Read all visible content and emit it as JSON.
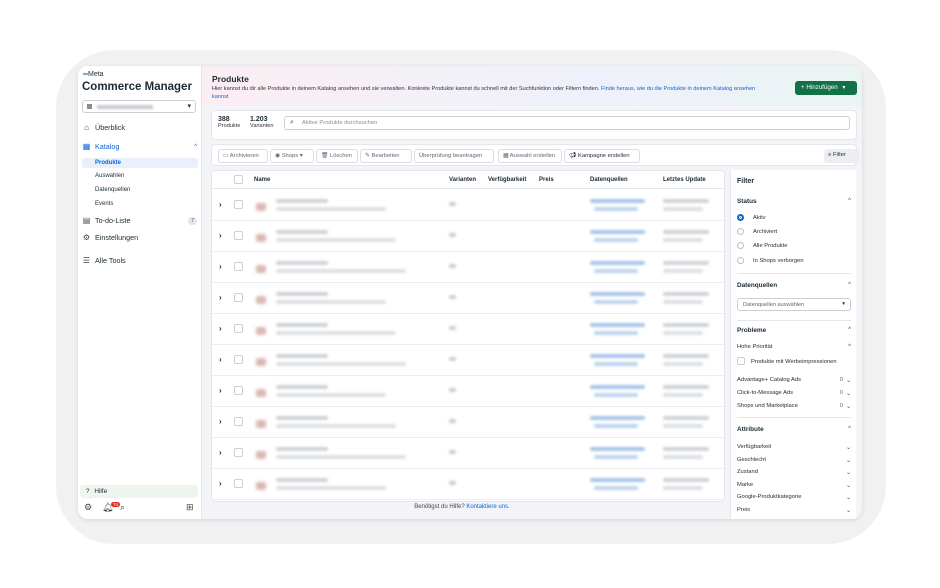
{
  "sidebar": {
    "brand": "Meta",
    "app_title": "Commerce Manager",
    "nav": {
      "overview": "Überblick",
      "catalog": "Katalog",
      "todo": "To-do-Liste",
      "todo_count": "7",
      "settings": "Einstellungen",
      "all_tools": "Alle Tools"
    },
    "catalog_sub": [
      "Produkte",
      "Auswahlen",
      "Datenquellen",
      "Events"
    ],
    "help": "Hilfe",
    "notification_count": "74"
  },
  "header": {
    "title": "Produkte",
    "description": "Hier kannst du dir alle Produkte in deinem Katalog ansehen und sie verwalten. Konkrete Produkte kannst du schnell mit der Suchfunktion oder Filtern finden.",
    "link": "Finde heraus, wie du die Produkte in deinem Katalog ansehen kannst",
    "add_button": "Hinzufügen"
  },
  "stats": {
    "products_count": "388",
    "products_label": "Produkte",
    "variants_count": "1.203",
    "variants_label": "Varianten"
  },
  "search": {
    "placeholder": "Aktive Produkte durchsuchen"
  },
  "toolbar": {
    "archive": "Archivieren",
    "shops": "Shops",
    "delete": "Löschen",
    "edit": "Bearbeiten",
    "review": "Überprüfung beantragen",
    "selection": "Auswahl erstellen",
    "campaign": "Kampagne erstellen",
    "filter": "Filter"
  },
  "table": {
    "columns": [
      "Name",
      "Varianten",
      "Verfügbarkeit",
      "Preis",
      "Datenquellen",
      "Letztes Update"
    ],
    "row_count": 10
  },
  "footer": {
    "text": "Benötigst du Hilfe?",
    "link": "Kontaktiere uns."
  },
  "filters": {
    "title": "Filter",
    "status": {
      "title": "Status",
      "options": [
        "Aktiv",
        "Archiviert",
        "Alle Produkte",
        "In Shops verborgen"
      ],
      "selected": "Aktiv"
    },
    "datasources": {
      "title": "Datenquellen",
      "select_placeholder": "Datenquellen auswählen"
    },
    "problems": {
      "title": "Probleme",
      "high_priority": "Hohe Priorität",
      "checkbox": "Produkte mit Werbeimpressionen",
      "items": [
        {
          "label": "Advantage+ Catalog Ads",
          "count": "0"
        },
        {
          "label": "Click-to-Message Ads",
          "count": "0"
        },
        {
          "label": "Shops und Marketplace",
          "count": "0"
        }
      ]
    },
    "attributes": {
      "title": "Attribute",
      "items": [
        "Verfügbarkeit",
        "Geschlecht",
        "Zustand",
        "Marke",
        "Google-Produktkategorie",
        "Preis"
      ]
    }
  }
}
